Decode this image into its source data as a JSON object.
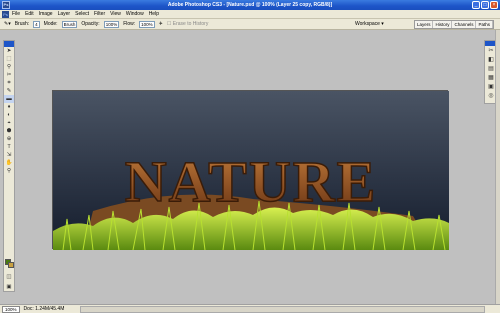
{
  "window": {
    "title": "Adobe Photoshop CS3 - [Nature.psd @ 100% (Layer 25 copy, RGB/8)]",
    "app_badge": "Ps",
    "minimize": "_",
    "maximize": "□",
    "close": "×"
  },
  "menu": {
    "items": [
      "File",
      "Edit",
      "Image",
      "Layer",
      "Select",
      "Filter",
      "View",
      "Window",
      "Help"
    ]
  },
  "options": {
    "brush_label": "Brush:",
    "brush_size": "4",
    "mode_label": "Mode:",
    "mode_value": "Brush",
    "opacity_label": "Opacity:",
    "opacity_value": "100%",
    "flow_label": "Flow:",
    "flow_value": "100%",
    "erase_history_label": "Erase to History",
    "workspace_label": "Workspace ▾",
    "panel_tabs": [
      "Layers",
      "History",
      "Channels",
      "Paths"
    ]
  },
  "tools": [
    "➤",
    "⬚",
    "⚲",
    "✂",
    "⌗",
    "✎",
    "▬",
    "♦",
    "◐",
    "⌖",
    "⬢",
    "⊕",
    "T",
    "⇲",
    "✋",
    "⚲"
  ],
  "right_panel_icons": [
    "✂",
    "◧",
    "▤",
    "▦",
    "▣",
    "◎",
    "≡"
  ],
  "canvas": {
    "text": "NATURE"
  },
  "status": {
    "zoom": "100%",
    "doc": "Doc: 1.24M/45.4M"
  },
  "colors": {
    "sky_top": "#46505e",
    "sky_bottom": "#1a2232",
    "grass": "#9ad21e",
    "wood": "#8a4a22"
  }
}
